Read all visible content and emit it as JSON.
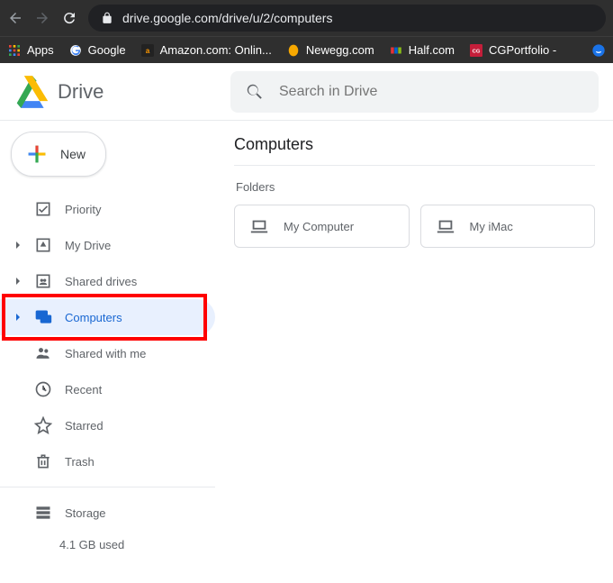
{
  "browser": {
    "url": "drive.google.com/drive/u/2/computers",
    "bookmarks": [
      "Apps",
      "Google",
      "Amazon.com: Onlin...",
      "Newegg.com",
      "Half.com",
      "CGPortfolio -"
    ]
  },
  "header": {
    "product": "Drive",
    "search_placeholder": "Search in Drive"
  },
  "sidebar": {
    "new_label": "New",
    "items": {
      "priority": "Priority",
      "mydrive": "My Drive",
      "shared_drives": "Shared drives",
      "computers": "Computers",
      "shared_with_me": "Shared with me",
      "recent": "Recent",
      "starred": "Starred",
      "trash": "Trash",
      "storage": "Storage"
    },
    "storage_used": "4.1 GB used"
  },
  "main": {
    "title": "Computers",
    "section_label": "Folders",
    "folders": {
      "f0": "My Computer",
      "f1": "My iMac"
    }
  }
}
